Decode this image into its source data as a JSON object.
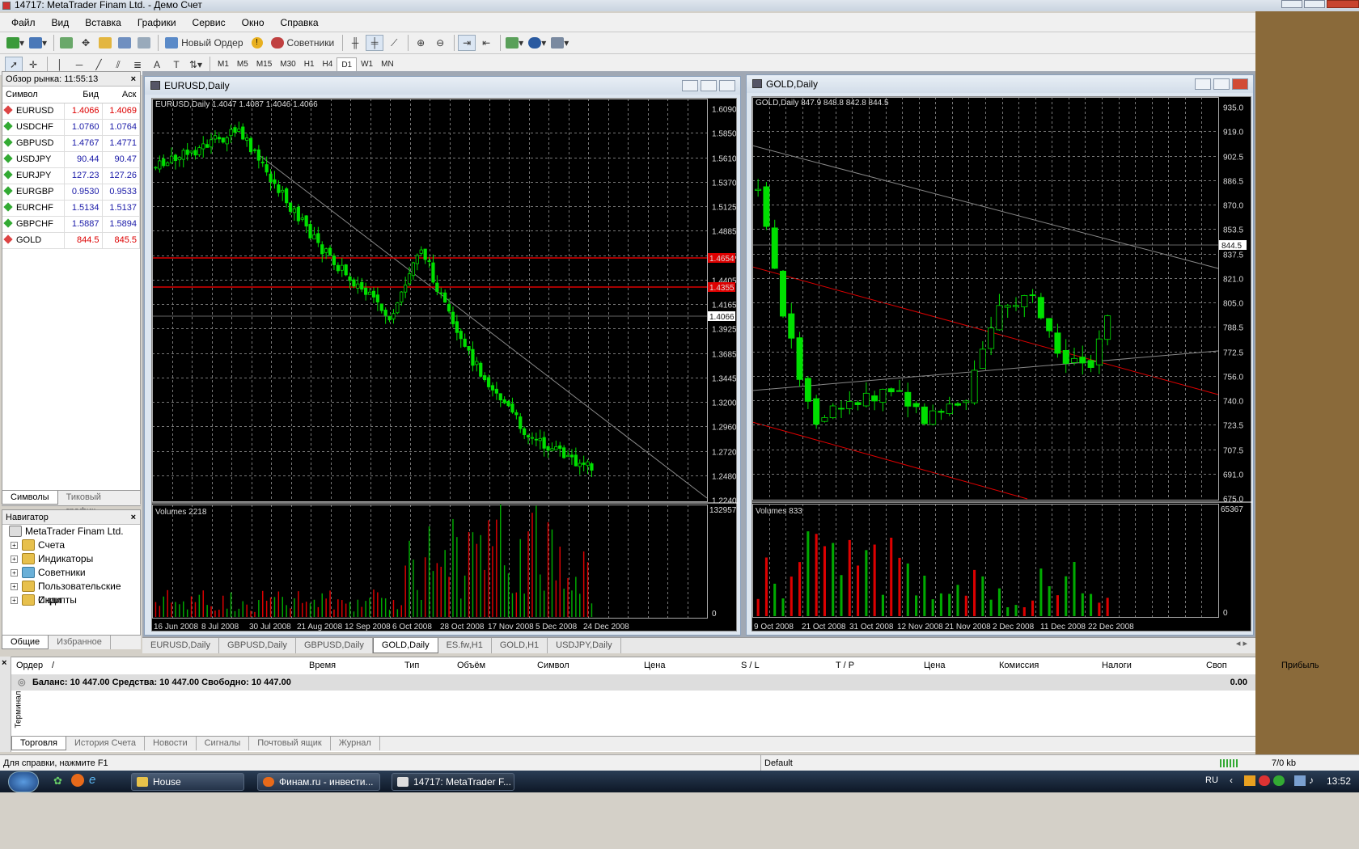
{
  "window": {
    "title": "14717: MetaTrader Finam Ltd. - Демо Счет"
  },
  "menu": [
    "Файл",
    "Вид",
    "Вставка",
    "Графики",
    "Сервис",
    "Окно",
    "Справка"
  ],
  "toolbar": {
    "new_order": "Новый Ордер",
    "advisors": "Советники"
  },
  "timeframes": [
    "M1",
    "M5",
    "M15",
    "M30",
    "H1",
    "H4",
    "D1",
    "W1",
    "MN"
  ],
  "active_timeframe": "D1",
  "market_watch": {
    "title": "Обзор рынка: 11:55:13",
    "col_symbol": "Символ",
    "col_bid": "Бид",
    "col_ask": "Аск",
    "rows": [
      {
        "symbol": "EURUSD",
        "bid": "1.4066",
        "ask": "1.4069",
        "dir": "down"
      },
      {
        "symbol": "USDCHF",
        "bid": "1.0760",
        "ask": "1.0764",
        "dir": "up"
      },
      {
        "symbol": "GBPUSD",
        "bid": "1.4767",
        "ask": "1.4771",
        "dir": "up"
      },
      {
        "symbol": "USDJPY",
        "bid": "90.44",
        "ask": "90.47",
        "dir": "up"
      },
      {
        "symbol": "EURJPY",
        "bid": "127.23",
        "ask": "127.26",
        "dir": "up"
      },
      {
        "symbol": "EURGBP",
        "bid": "0.9530",
        "ask": "0.9533",
        "dir": "up"
      },
      {
        "symbol": "EURCHF",
        "bid": "1.5134",
        "ask": "1.5137",
        "dir": "up"
      },
      {
        "symbol": "GBPCHF",
        "bid": "1.5887",
        "ask": "1.5894",
        "dir": "up"
      },
      {
        "symbol": "GOLD",
        "bid": "844.5",
        "ask": "845.5",
        "dir": "down"
      }
    ],
    "tabs": [
      "Символы",
      "Тиковый график"
    ]
  },
  "navigator": {
    "title": "Навигатор",
    "root": "MetaTrader Finam Ltd.",
    "items": [
      "Счета",
      "Индикаторы",
      "Советники",
      "Пользовательские Инди",
      "Скрипты"
    ],
    "tabs": [
      "Общие",
      "Избранное"
    ]
  },
  "chart_eur": {
    "window_title": "EURUSD,Daily",
    "info": "EURUSD,Daily  1.4047 1.4087 1.4046 1.4066",
    "volumes_label": "Volumes 2218",
    "price_ticks": [
      "1.6090",
      "1.5850",
      "1.5610",
      "1.5370",
      "1.5125",
      "1.4885",
      "1.4645",
      "1.4405",
      "1.4165",
      "1.3925",
      "1.3685",
      "1.3445",
      "1.3200",
      "1.2960",
      "1.2720",
      "1.2480",
      "1.2240"
    ],
    "hline_labels": [
      "1.4654",
      "1.4355"
    ],
    "current_price": "1.4066",
    "vol_ticks": [
      "132957",
      "0"
    ],
    "dates": [
      "16 Jun 2008",
      "8 Jul 2008",
      "30 Jul 2008",
      "21 Aug 2008",
      "12 Sep 2008",
      "6 Oct 2008",
      "28 Oct 2008",
      "17 Nov 2008",
      "5 Dec 2008",
      "24 Dec 2008"
    ]
  },
  "chart_gold": {
    "window_title": "GOLD,Daily",
    "info": "GOLD,Daily  847.9 848.8 842.8 844.5",
    "volumes_label": "Volumes 833",
    "price_ticks": [
      "935.0",
      "919.0",
      "902.5",
      "886.5",
      "870.0",
      "853.5",
      "837.5",
      "821.0",
      "805.0",
      "788.5",
      "772.5",
      "756.0",
      "740.0",
      "723.5",
      "707.5",
      "691.0",
      "675.0"
    ],
    "current_price": "844.5",
    "vol_ticks": [
      "65367",
      "0"
    ],
    "dates": [
      "9 Oct 2008",
      "21 Oct 2008",
      "31 Oct 2008",
      "12 Nov 2008",
      "21 Nov 2008",
      "2 Dec 2008",
      "11 Dec 2008",
      "22 Dec 2008"
    ]
  },
  "chart_tabs": [
    "EURUSD,Daily",
    "GBPUSD,Daily",
    "GBPUSD,Daily",
    "GOLD,Daily",
    "ES.fw,H1",
    "GOLD,H1",
    "USDJPY,Daily"
  ],
  "active_chart_tab": "GOLD,Daily",
  "terminal": {
    "side_label": "Терминал",
    "headers": [
      "Ордер",
      "/",
      "Время",
      "Тип",
      "Объём",
      "Символ",
      "Цена",
      "S / L",
      "T / P",
      "Цена",
      "Комиссия",
      "Налоги",
      "Своп",
      "Прибыль"
    ],
    "balance": "Баланс: 10 447.00  Средства: 10 447.00  Свободно: 10 447.00",
    "profit": "0.00",
    "tabs": [
      "Торговля",
      "История Счета",
      "Новости",
      "Сигналы",
      "Почтовый ящик",
      "Журнал"
    ]
  },
  "status": {
    "help": "Для справки, нажмите F1",
    "profile": "Default",
    "traffic": "7/0 kb"
  },
  "taskbar": {
    "tasks": [
      "House",
      "Финам.ru - инвести...",
      "14717: MetaTrader F..."
    ],
    "lang": "RU",
    "time": "13:52"
  }
}
